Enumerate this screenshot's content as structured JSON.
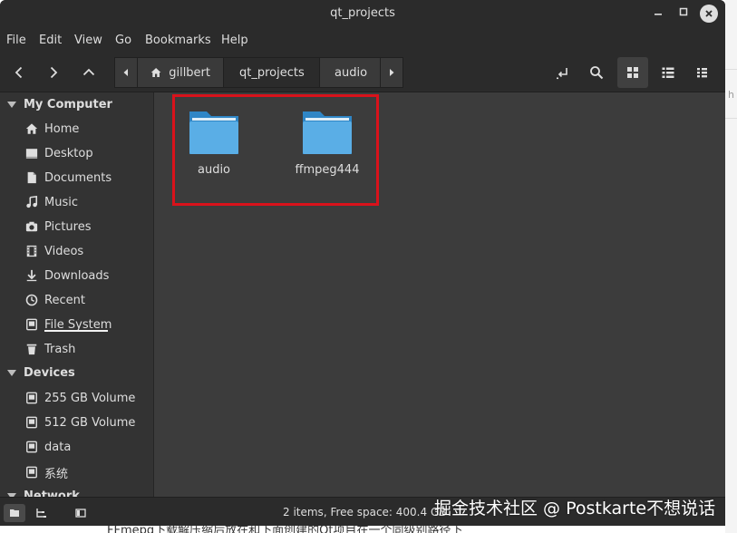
{
  "window": {
    "title": "qt_projects"
  },
  "menu": [
    "File",
    "Edit",
    "View",
    "Go",
    "Bookmarks",
    "Help"
  ],
  "breadcrumb": {
    "items": [
      "gillbert",
      "qt_projects",
      "audio"
    ],
    "active_index": 1
  },
  "sidebar": {
    "sections": [
      {
        "title": "My Computer",
        "items": [
          {
            "label": "Home",
            "icon": "home-icon"
          },
          {
            "label": "Desktop",
            "icon": "desktop-icon"
          },
          {
            "label": "Documents",
            "icon": "document-icon"
          },
          {
            "label": "Music",
            "icon": "music-icon"
          },
          {
            "label": "Pictures",
            "icon": "camera-icon"
          },
          {
            "label": "Videos",
            "icon": "film-icon"
          },
          {
            "label": "Downloads",
            "icon": "download-icon"
          },
          {
            "label": "Recent",
            "icon": "clock-icon"
          },
          {
            "label": "File System",
            "icon": "drive-icon"
          },
          {
            "label": "Trash",
            "icon": "trash-icon"
          }
        ]
      },
      {
        "title": "Devices",
        "items": [
          {
            "label": "255 GB Volume",
            "icon": "disk-icon"
          },
          {
            "label": "512 GB Volume",
            "icon": "disk-icon"
          },
          {
            "label": "data",
            "icon": "disk-icon"
          },
          {
            "label": "系统",
            "icon": "disk-icon"
          }
        ]
      },
      {
        "title": "Network",
        "items": []
      }
    ]
  },
  "files": [
    {
      "name": "audio",
      "type": "folder"
    },
    {
      "name": "ffmpeg444",
      "type": "folder"
    }
  ],
  "status": {
    "text": "2 items, Free space: 400.4 GB"
  },
  "colors": {
    "folder": "#5aaee6",
    "folder_tab": "#2f86c6",
    "highlight": "#d9121b",
    "window_bg": "#3c3c3c",
    "chrome_bg": "#2b2b2b"
  },
  "overlay": {
    "watermark": "掘金技术社区 @ Postkarte不想说话",
    "background_caption": "FFmepg下载解压缩后放在和下面创建的Qt项目在一个同级别路径下",
    "right_edge_fragment": "h"
  }
}
